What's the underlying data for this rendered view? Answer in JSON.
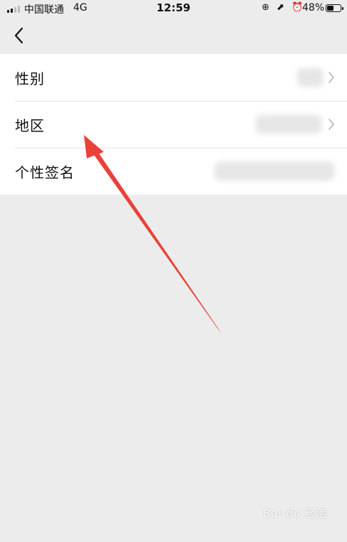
{
  "status_bar": {
    "carrier": "中国联通",
    "network": "4G",
    "time": "12:59",
    "status_icons": "⊕ ⬈ ⏰",
    "battery_percent": "48%",
    "battery_level": 0.48
  },
  "nav": {
    "back_icon": "chevron-left-icon"
  },
  "rows": [
    {
      "label": "性别",
      "value": ""
    },
    {
      "label": "地区",
      "value": ""
    },
    {
      "label": "个性签名",
      "value": ""
    }
  ],
  "colors": {
    "background": "#ececec",
    "row_background": "#ffffff",
    "annotation_arrow": "#e8423a"
  },
  "watermark": {
    "text": "Bai du 经验"
  }
}
